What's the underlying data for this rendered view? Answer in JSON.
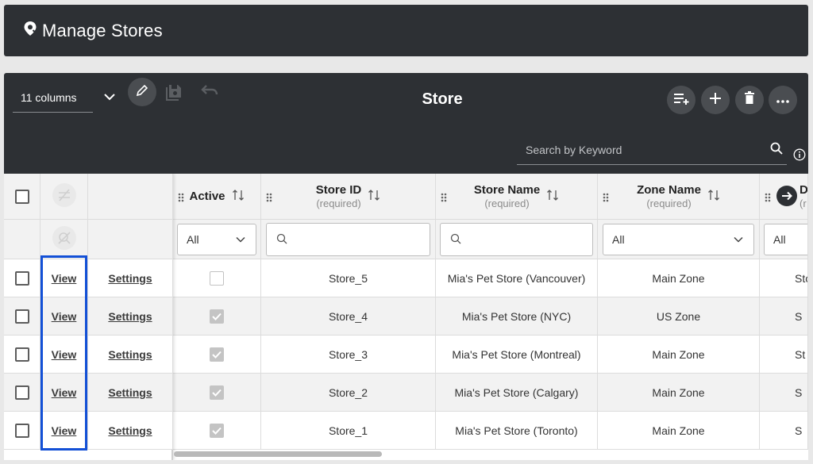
{
  "header": {
    "title": "Manage Stores",
    "icon": "map-pin-icon"
  },
  "toolbar": {
    "column_select": "11 columns",
    "title": "Store",
    "search_placeholder": "Search by Keyword"
  },
  "columns": {
    "active": "Active",
    "store_id": "Store ID",
    "store_name": "Store Name",
    "zone_name": "Zone Name",
    "partial_col": "D",
    "partial_sub": "(r",
    "required": "(required)"
  },
  "filters": {
    "active": "All",
    "zone_name": "All",
    "partial": "All"
  },
  "rows": [
    {
      "view": "View",
      "settings": "Settings",
      "active": false,
      "store_id": "Store_5",
      "store_name": "Mia's Pet Store (Vancouver)",
      "zone": "Main Zone",
      "partial": "Sto"
    },
    {
      "view": "View",
      "settings": "Settings",
      "active": true,
      "store_id": "Store_4",
      "store_name": "Mia's Pet Store (NYC)",
      "zone": "US Zone",
      "partial": "S"
    },
    {
      "view": "View",
      "settings": "Settings",
      "active": true,
      "store_id": "Store_3",
      "store_name": "Mia's Pet Store (Montreal)",
      "zone": "Main Zone",
      "partial": "St"
    },
    {
      "view": "View",
      "settings": "Settings",
      "active": true,
      "store_id": "Store_2",
      "store_name": "Mia's Pet Store (Calgary)",
      "zone": "Main Zone",
      "partial": "S"
    },
    {
      "view": "View",
      "settings": "Settings",
      "active": true,
      "store_id": "Store_1",
      "store_name": "Mia's Pet Store (Toronto)",
      "zone": "Main Zone",
      "partial": "S"
    }
  ],
  "colors": {
    "panel": "#2d3034",
    "highlight": "#1350d6"
  }
}
